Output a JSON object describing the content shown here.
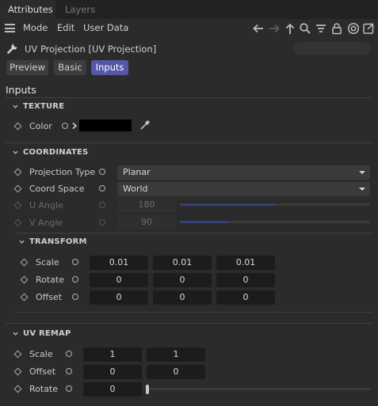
{
  "tabs": {
    "attributes": "Attributes",
    "layers": "Layers"
  },
  "menu": {
    "mode": "Mode",
    "edit": "Edit",
    "user_data": "User Data"
  },
  "object_title": "UV Projection [UV Projection]",
  "mode_buttons": {
    "preview": "Preview",
    "basic": "Basic",
    "inputs": "Inputs"
  },
  "inputs_title": "Inputs",
  "texture": {
    "header": "TEXTURE",
    "color_label": "Color",
    "color_value": "#000000"
  },
  "coordinates": {
    "header": "COORDINATES",
    "projection_type": {
      "label": "Projection Type",
      "value": "Planar"
    },
    "coord_space": {
      "label": "Coord Space",
      "value": "World"
    },
    "u_angle": {
      "label": "U Angle",
      "value": "180",
      "fraction": 0.5
    },
    "v_angle": {
      "label": "V Angle",
      "value": "90",
      "fraction": 0.25
    }
  },
  "transform": {
    "header": "TRANSFORM",
    "scale": {
      "label": "Scale",
      "x": "0.01",
      "y": "0.01",
      "z": "0.01"
    },
    "rotate": {
      "label": "Rotate",
      "x": "0",
      "y": "0",
      "z": "0"
    },
    "offset": {
      "label": "Offset",
      "x": "0",
      "y": "0",
      "z": "0"
    }
  },
  "uv_remap": {
    "header": "UV REMAP",
    "scale": {
      "label": "Scale",
      "u": "1",
      "v": "1"
    },
    "offset": {
      "label": "Offset",
      "u": "0",
      "v": "0"
    },
    "rotate": {
      "label": "Rotate",
      "value": "0",
      "fraction": 0
    }
  },
  "colors": {
    "accent": "#5556a8",
    "slider_fill": "#36407a"
  },
  "icons": [
    "hamburger-icon",
    "back-arrow-icon",
    "forward-arrow-icon",
    "up-arrow-icon",
    "search-icon",
    "filter-icon",
    "lock-icon",
    "target-icon",
    "new-window-icon",
    "wrench-icon",
    "eyedropper-icon"
  ]
}
